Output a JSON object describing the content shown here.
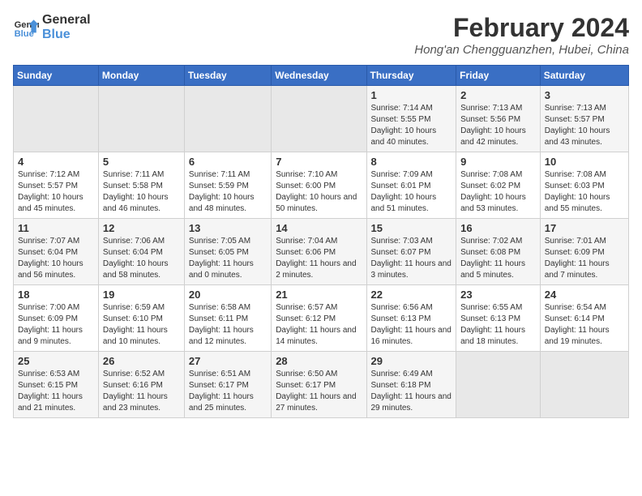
{
  "header": {
    "logo_line1": "General",
    "logo_line2": "Blue",
    "title": "February 2024",
    "subtitle": "Hong'an Chengguanzhen, Hubei, China"
  },
  "weekdays": [
    "Sunday",
    "Monday",
    "Tuesday",
    "Wednesday",
    "Thursday",
    "Friday",
    "Saturday"
  ],
  "weeks": [
    [
      {
        "day": "",
        "empty": true
      },
      {
        "day": "",
        "empty": true
      },
      {
        "day": "",
        "empty": true
      },
      {
        "day": "",
        "empty": true
      },
      {
        "day": "1",
        "sunrise": "7:14 AM",
        "sunset": "5:55 PM",
        "daylight": "10 hours and 40 minutes."
      },
      {
        "day": "2",
        "sunrise": "7:13 AM",
        "sunset": "5:56 PM",
        "daylight": "10 hours and 42 minutes."
      },
      {
        "day": "3",
        "sunrise": "7:13 AM",
        "sunset": "5:57 PM",
        "daylight": "10 hours and 43 minutes."
      }
    ],
    [
      {
        "day": "4",
        "sunrise": "7:12 AM",
        "sunset": "5:57 PM",
        "daylight": "10 hours and 45 minutes."
      },
      {
        "day": "5",
        "sunrise": "7:11 AM",
        "sunset": "5:58 PM",
        "daylight": "10 hours and 46 minutes."
      },
      {
        "day": "6",
        "sunrise": "7:11 AM",
        "sunset": "5:59 PM",
        "daylight": "10 hours and 48 minutes."
      },
      {
        "day": "7",
        "sunrise": "7:10 AM",
        "sunset": "6:00 PM",
        "daylight": "10 hours and 50 minutes."
      },
      {
        "day": "8",
        "sunrise": "7:09 AM",
        "sunset": "6:01 PM",
        "daylight": "10 hours and 51 minutes."
      },
      {
        "day": "9",
        "sunrise": "7:08 AM",
        "sunset": "6:02 PM",
        "daylight": "10 hours and 53 minutes."
      },
      {
        "day": "10",
        "sunrise": "7:08 AM",
        "sunset": "6:03 PM",
        "daylight": "10 hours and 55 minutes."
      }
    ],
    [
      {
        "day": "11",
        "sunrise": "7:07 AM",
        "sunset": "6:04 PM",
        "daylight": "10 hours and 56 minutes."
      },
      {
        "day": "12",
        "sunrise": "7:06 AM",
        "sunset": "6:04 PM",
        "daylight": "10 hours and 58 minutes."
      },
      {
        "day": "13",
        "sunrise": "7:05 AM",
        "sunset": "6:05 PM",
        "daylight": "11 hours and 0 minutes."
      },
      {
        "day": "14",
        "sunrise": "7:04 AM",
        "sunset": "6:06 PM",
        "daylight": "11 hours and 2 minutes."
      },
      {
        "day": "15",
        "sunrise": "7:03 AM",
        "sunset": "6:07 PM",
        "daylight": "11 hours and 3 minutes."
      },
      {
        "day": "16",
        "sunrise": "7:02 AM",
        "sunset": "6:08 PM",
        "daylight": "11 hours and 5 minutes."
      },
      {
        "day": "17",
        "sunrise": "7:01 AM",
        "sunset": "6:09 PM",
        "daylight": "11 hours and 7 minutes."
      }
    ],
    [
      {
        "day": "18",
        "sunrise": "7:00 AM",
        "sunset": "6:09 PM",
        "daylight": "11 hours and 9 minutes."
      },
      {
        "day": "19",
        "sunrise": "6:59 AM",
        "sunset": "6:10 PM",
        "daylight": "11 hours and 10 minutes."
      },
      {
        "day": "20",
        "sunrise": "6:58 AM",
        "sunset": "6:11 PM",
        "daylight": "11 hours and 12 minutes."
      },
      {
        "day": "21",
        "sunrise": "6:57 AM",
        "sunset": "6:12 PM",
        "daylight": "11 hours and 14 minutes."
      },
      {
        "day": "22",
        "sunrise": "6:56 AM",
        "sunset": "6:13 PM",
        "daylight": "11 hours and 16 minutes."
      },
      {
        "day": "23",
        "sunrise": "6:55 AM",
        "sunset": "6:13 PM",
        "daylight": "11 hours and 18 minutes."
      },
      {
        "day": "24",
        "sunrise": "6:54 AM",
        "sunset": "6:14 PM",
        "daylight": "11 hours and 19 minutes."
      }
    ],
    [
      {
        "day": "25",
        "sunrise": "6:53 AM",
        "sunset": "6:15 PM",
        "daylight": "11 hours and 21 minutes."
      },
      {
        "day": "26",
        "sunrise": "6:52 AM",
        "sunset": "6:16 PM",
        "daylight": "11 hours and 23 minutes."
      },
      {
        "day": "27",
        "sunrise": "6:51 AM",
        "sunset": "6:17 PM",
        "daylight": "11 hours and 25 minutes."
      },
      {
        "day": "28",
        "sunrise": "6:50 AM",
        "sunset": "6:17 PM",
        "daylight": "11 hours and 27 minutes."
      },
      {
        "day": "29",
        "sunrise": "6:49 AM",
        "sunset": "6:18 PM",
        "daylight": "11 hours and 29 minutes."
      },
      {
        "day": "",
        "empty": true
      },
      {
        "day": "",
        "empty": true
      }
    ]
  ],
  "labels": {
    "sunrise_prefix": "Sunrise: ",
    "sunset_prefix": "Sunset: ",
    "daylight_prefix": "Daylight: "
  }
}
